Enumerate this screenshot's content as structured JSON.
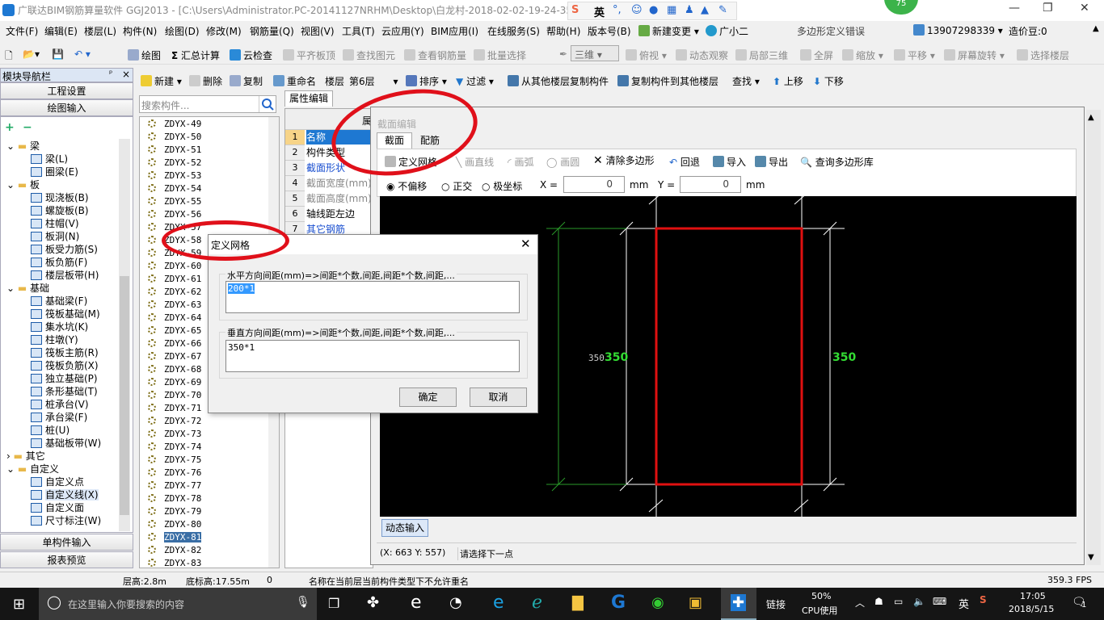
{
  "title_bar": {
    "text": "广联达BIM钢筋算量软件 GGJ2013 - [C:\\Users\\Administrator.PC-20141127NRHM\\Desktop\\白龙村-2018-02-02-19-24-35",
    "badge": "75",
    "ime": {
      "lang": "英"
    }
  },
  "menu": [
    "文件(F)",
    "编辑(E)",
    "楼层(L)",
    "构件(N)",
    "绘图(D)",
    "修改(M)",
    "钢筋量(Q)",
    "视图(V)",
    "工具(T)",
    "云应用(Y)",
    "BIM应用(I)",
    "在线服务(S)",
    "帮助(H)",
    "版本号(B)",
    "新建变更",
    "广小二"
  ],
  "menu_right": {
    "error_text": "多边形定义错误",
    "phone": "13907298339",
    "price": "造价豆:0"
  },
  "toolbar1": {
    "draw": "绘图",
    "sum": "汇总计算",
    "cloud_check": "云检查",
    "flat_board": "平齐板顶",
    "find_elem": "查找图元",
    "view_rebar": "查看钢筋量",
    "batch_select": "批量选择",
    "view3d": "三维",
    "top_view": "俯视",
    "dynamic": "动态观察",
    "local3d": "局部三维",
    "fullscreen": "全屏",
    "zoom": "缩放",
    "pan": "平移",
    "rotate": "屏幕旋转",
    "select_floor": "选择楼层"
  },
  "toolbar2": {
    "new": "新建",
    "delete": "删除",
    "copy": "复制",
    "rename": "重命名",
    "floor_label": "楼层",
    "floor_value": "第6层",
    "sort": "排序",
    "filter": "过滤",
    "copy_from": "从其他楼层复制构件",
    "copy_to": "复制构件到其他楼层",
    "find": "查找",
    "up": "上移",
    "down": "下移"
  },
  "nav": {
    "header": "模块导航栏",
    "project_settings": "工程设置",
    "drawing_input": "绘图输入",
    "single_input": "单构件输入",
    "report_preview": "报表预览",
    "tree": [
      {
        "label": "梁",
        "level": 0
      },
      {
        "label": "梁(L)",
        "level": 1
      },
      {
        "label": "圈梁(E)",
        "level": 1
      },
      {
        "label": "板",
        "level": 0
      },
      {
        "label": "现浇板(B)",
        "level": 1
      },
      {
        "label": "螺旋板(B)",
        "level": 1
      },
      {
        "label": "柱帽(V)",
        "level": 1
      },
      {
        "label": "板洞(N)",
        "level": 1
      },
      {
        "label": "板受力筋(S)",
        "level": 1
      },
      {
        "label": "板负筋(F)",
        "level": 1
      },
      {
        "label": "楼层板带(H)",
        "level": 1
      },
      {
        "label": "基础",
        "level": 0
      },
      {
        "label": "基础梁(F)",
        "level": 1
      },
      {
        "label": "筏板基础(M)",
        "level": 1
      },
      {
        "label": "集水坑(K)",
        "level": 1
      },
      {
        "label": "柱墩(Y)",
        "level": 1
      },
      {
        "label": "筏板主筋(R)",
        "level": 1
      },
      {
        "label": "筏板负筋(X)",
        "level": 1
      },
      {
        "label": "独立基础(P)",
        "level": 1
      },
      {
        "label": "条形基础(T)",
        "level": 1
      },
      {
        "label": "桩承台(V)",
        "level": 1
      },
      {
        "label": "承台梁(F)",
        "level": 1
      },
      {
        "label": "桩(U)",
        "level": 1
      },
      {
        "label": "基础板带(W)",
        "level": 1
      },
      {
        "label": "其它",
        "level": 0
      },
      {
        "label": "自定义",
        "level": 0
      },
      {
        "label": "自定义点",
        "level": 1
      },
      {
        "label": "自定义线(X)",
        "level": 1
      },
      {
        "label": "自定义面",
        "level": 1
      },
      {
        "label": "尺寸标注(W)",
        "level": 1
      }
    ]
  },
  "component_search_placeholder": "搜索构件...",
  "components": [
    "ZDYX-49",
    "ZDYX-50",
    "ZDYX-51",
    "ZDYX-52",
    "ZDYX-53",
    "ZDYX-54",
    "ZDYX-55",
    "ZDYX-56",
    "ZDYX-57",
    "ZDYX-58",
    "ZDYX-59",
    "ZDYX-60",
    "ZDYX-61",
    "ZDYX-62",
    "ZDYX-63",
    "ZDYX-64",
    "ZDYX-65",
    "ZDYX-66",
    "ZDYX-67",
    "ZDYX-68",
    "ZDYX-69",
    "ZDYX-70",
    "ZDYX-71",
    "ZDYX-72",
    "ZDYX-73",
    "ZDYX-74",
    "ZDYX-75",
    "ZDYX-76",
    "ZDYX-77",
    "ZDYX-78",
    "ZDYX-79",
    "ZDYX-80",
    "ZDYX-81",
    "ZDYX-82",
    "ZDYX-83"
  ],
  "selected_component": "ZDYX-81",
  "property": {
    "tab": "属性编辑",
    "header": "属",
    "rows": [
      {
        "num": "1",
        "name": "名称"
      },
      {
        "num": "2",
        "name": "构件类型"
      },
      {
        "num": "3",
        "name": "截面形状"
      },
      {
        "num": "4",
        "name": "截面宽度(mm)"
      },
      {
        "num": "5",
        "name": "截面高度(mm)"
      },
      {
        "num": "6",
        "name": "轴线距左边"
      },
      {
        "num": "7",
        "name": "其它钢筋"
      }
    ]
  },
  "section_editor": {
    "title": "截面编辑",
    "tabs": [
      "截面",
      "配筋"
    ],
    "toolbar": {
      "define_grid": "定义网格",
      "line": "画直线",
      "arc": "画弧",
      "circle": "画圆",
      "clear": "清除多边形",
      "undo": "回退",
      "import": "导入",
      "export": "导出",
      "query": "查询多边形库"
    },
    "modes": [
      "不偏移",
      "正交",
      "极坐标"
    ],
    "x_label": "X =",
    "x_value": "0",
    "y_label": "Y =",
    "y_value": "0",
    "unit": "mm",
    "dim_left_small": "350",
    "dim_left": "350",
    "dim_right": "350",
    "dynamic_input": "动态输入",
    "coords": "(X: 663 Y: 557)",
    "prompt": "请选择下一点"
  },
  "dialog": {
    "title": "定义网格",
    "h_label": "水平方向间距(mm)=>间距*个数,间距,间距*个数,间距,...",
    "h_value": "200*1",
    "v_label": "垂直方向间距(mm)=>间距*个数,间距,间距*个数,间距,...",
    "v_value": "350*1",
    "ok": "确定",
    "cancel": "取消"
  },
  "status": {
    "floor_height": "层高:2.8m",
    "base_height": "底标高:17.55m",
    "zero": "0",
    "message": "名称在当前层当前构件类型下不允许重名",
    "fps": "359.3 FPS"
  },
  "taskbar": {
    "search_placeholder": "在这里输入你要搜索的内容",
    "link": "链接",
    "cpu_pct": "50%",
    "cpu_label": "CPU使用",
    "ime": "英",
    "time": "17:05",
    "date": "2018/5/15",
    "notif": "1"
  },
  "colors": {
    "accent": "#e0101a",
    "canvas_bg": "#000000",
    "shape": "#e01010",
    "dim": "#33dd33",
    "selection": "#3399ff"
  }
}
